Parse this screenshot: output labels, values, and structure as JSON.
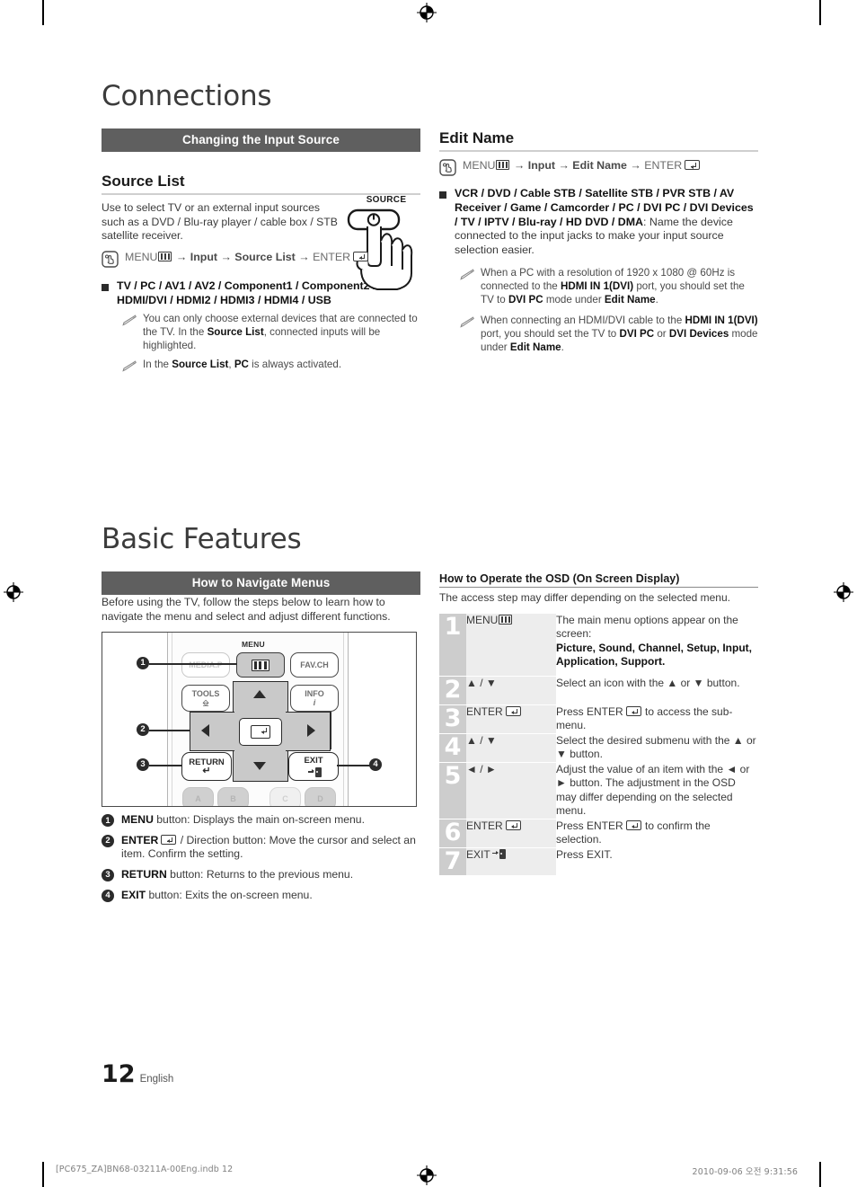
{
  "chapters": {
    "connections": "Connections",
    "basic_features": "Basic Features"
  },
  "bars": {
    "changing_input_source": "Changing the Input Source",
    "how_to_navigate_menus": "How to Navigate Menus"
  },
  "source_list": {
    "heading": "Source List",
    "intro": "Use to select TV or an external input sources such as a DVD / Blu-ray player / cable box / STB satellite receiver.",
    "path_menu": "MENU",
    "path_mid": " → Input → Source List → ",
    "path_enter": "ENTER",
    "bullet": "TV / PC / AV1 / AV2 / Component1 / Component2 / HDMI/DVI / HDMI2 / HDMI3 / HDMI4 / USB",
    "note1_a": "You can only choose external devices that are connected to the TV. In the ",
    "note1_b": "Source List",
    "note1_c": ", connected inputs will be highlighted.",
    "note2_a": "In the ",
    "note2_b": "Source List",
    "note2_c": ", ",
    "note2_d": "PC",
    "note2_e": " is always activated.",
    "remote_button_label": "SOURCE"
  },
  "edit_name": {
    "heading": "Edit Name",
    "path_menu": "MENU",
    "path_mid": " → Input → Edit Name → ",
    "path_enter": "ENTER",
    "bullet_bold": "VCR / DVD / Cable STB / Satellite STB / PVR STB / AV Receiver / Game / Camcorder / PC / DVI PC / DVI Devices / TV / IPTV / Blu-ray / HD DVD / DMA",
    "bullet_rest": ": Name the device connected to the input jacks to make your input source selection easier.",
    "note1_a": "When a PC with a resolution of 1920 x 1080 @ 60Hz is connected to the ",
    "note1_b": "HDMI IN 1(DVI)",
    "note1_c": " port, you should set the TV to ",
    "note1_d": "DVI PC",
    "note1_e": " mode under ",
    "note1_f": "Edit Name",
    "note1_g": ".",
    "note2_a": "When connecting an HDMI/DVI cable to the ",
    "note2_b": "HDMI IN 1(DVI)",
    "note2_c": " port, you should set the TV to ",
    "note2_d": "DVI PC",
    "note2_e": " or ",
    "note2_f": "DVI Devices",
    "note2_g": " mode under ",
    "note2_h": "Edit Name",
    "note2_i": "."
  },
  "navigate_menus": {
    "intro": "Before using the TV, follow the steps below to learn how to navigate the menu and select and adjust different functions.",
    "remote": {
      "label_menu": "MENU",
      "btn_media": "MEDIA.P",
      "btn_fav": "FAV.CH",
      "btn_tools": "TOOLS",
      "btn_info": "INFO",
      "btn_return": "RETURN",
      "btn_exit": "EXIT",
      "color_a": "A",
      "color_b": "B",
      "color_c": "C",
      "color_d": "D",
      "callouts": [
        "❶",
        "❷",
        "❸",
        "❹"
      ]
    },
    "legend": [
      {
        "num": "❶",
        "bold": "MENU",
        "text": " button: Displays the main on-screen menu."
      },
      {
        "num": "❷",
        "bold": "ENTER",
        "text": " / Direction button: Move the cursor and select an item. Confirm the setting.",
        "has_enter_glyph": true
      },
      {
        "num": "❸",
        "bold": "RETURN",
        "text": " button: Returns to the previous menu."
      },
      {
        "num": "❹",
        "bold": "EXIT",
        "text": " button: Exits the on-screen menu."
      }
    ]
  },
  "osd": {
    "heading": "How to Operate the OSD (On Screen Display)",
    "subtitle": "The access step may differ depending on the selected menu.",
    "rows": [
      {
        "num": "1",
        "key": "MENU",
        "key_glyph": "menu",
        "desc_pre": "The main menu options appear on the screen:",
        "desc_bold": "Picture, Sound, Channel, Setup, Input, Application, Support.",
        "desc_post": ""
      },
      {
        "num": "2",
        "key": "▲ / ▼",
        "key_glyph": "none",
        "desc_pre": "Select an icon with the ▲ or ▼ button.",
        "desc_bold": "",
        "desc_post": ""
      },
      {
        "num": "3",
        "key": "ENTER",
        "key_glyph": "enter",
        "desc_pre": "Press ENTER",
        "desc_bold": "",
        "desc_post": " to access the sub-menu.",
        "desc_glyph": "enter"
      },
      {
        "num": "4",
        "key": "▲ / ▼",
        "key_glyph": "none",
        "desc_pre": "Select the desired submenu with the ▲ or ▼ button.",
        "desc_bold": "",
        "desc_post": ""
      },
      {
        "num": "5",
        "key": "◄ / ►",
        "key_glyph": "none",
        "desc_pre": "Adjust the value of an item with the ◄ or ► button. The adjustment in the OSD may differ depending on the selected menu.",
        "desc_bold": "",
        "desc_post": ""
      },
      {
        "num": "6",
        "key": "ENTER",
        "key_glyph": "enter",
        "desc_pre": "Press ENTER",
        "desc_bold": "",
        "desc_post": " to confirm the selection.",
        "desc_glyph": "enter"
      },
      {
        "num": "7",
        "key": "EXIT",
        "key_glyph": "exit",
        "desc_pre": "Press EXIT.",
        "desc_bold": "",
        "desc_post": ""
      }
    ]
  },
  "footer": {
    "page_number": "12",
    "language": "English",
    "left": "[PC675_ZA]BN68-03211A-00Eng.indb   12",
    "right": "2010-09-06   오전 9:31:56"
  },
  "colors": {
    "bar": "#5f5f5f",
    "num_col": "#cdcdcd",
    "key_col": "#ededed",
    "text": "#3a3a3a"
  }
}
